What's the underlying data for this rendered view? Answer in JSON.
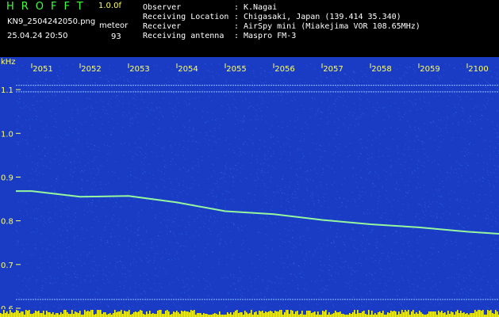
{
  "header": {
    "logo": "HROFFT",
    "version": "1.0.0f",
    "filename": "KN9_2504242050.png",
    "mode": "meteor",
    "datetime": "25.04.24 20:50",
    "count": "93",
    "info": [
      {
        "label": "Observer",
        "value": "K.Nagai"
      },
      {
        "label": "Receiving Location",
        "value": "Chigasaki, Japan (139.414 35.340)"
      },
      {
        "label": "Receiver",
        "value": "AirSpy mini (Miakejima VOR 108.65MHz)"
      },
      {
        "label": "Receiving antenna",
        "value": "Maspro FM-3"
      }
    ]
  },
  "chart_data": {
    "type": "heatmap",
    "ylabel": "kHz",
    "x_ticks": [
      "2051",
      "2052",
      "2053",
      "2054",
      "2055",
      "2056",
      "2057",
      "2058",
      "2059",
      "2100"
    ],
    "y_ticks": [
      "1.1",
      "1.0",
      "0.9",
      "0.8",
      "0.7",
      "0.6"
    ],
    "ylim": [
      0.58,
      1.16
    ],
    "colors": {
      "background": "#1a3cc4",
      "noise": "#3fa8ff",
      "signal": "#9dff9d",
      "axis_text": "#ffff66",
      "bottom_bar": "#ffff00"
    },
    "carrier_lines_khz": [
      1.11,
      1.095,
      0.62
    ],
    "trace": {
      "minute": [
        0,
        1,
        2,
        3,
        4,
        5,
        6,
        7,
        8,
        9,
        9.7
      ],
      "khz": [
        0.868,
        0.855,
        0.857,
        0.842,
        0.822,
        0.815,
        0.802,
        0.792,
        0.785,
        0.775,
        0.77
      ]
    }
  }
}
